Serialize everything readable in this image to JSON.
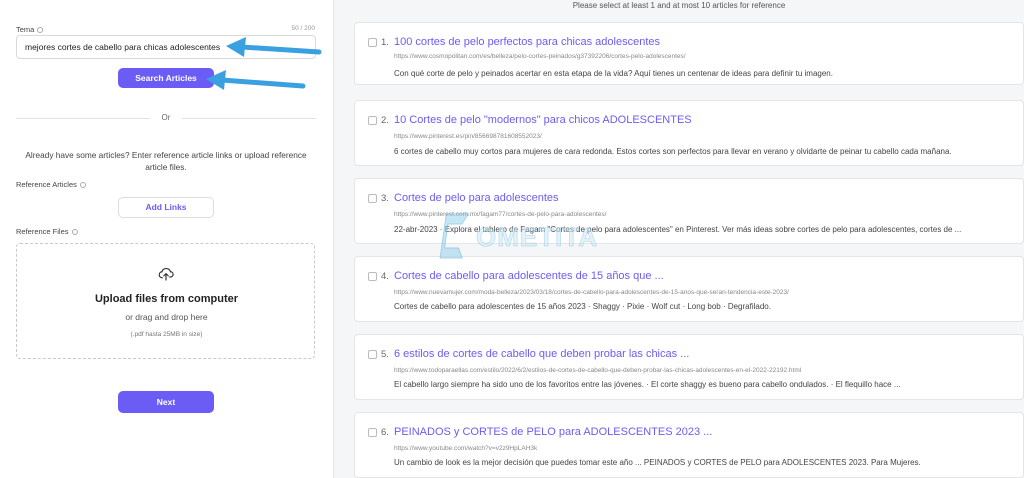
{
  "form": {
    "topic_label": "Tema",
    "counter": "50 / 200",
    "topic_value": "mejores cortes de cabello para chicas adolescentes",
    "search_button": "Search Articles",
    "or_text": "Or",
    "reference_text": "Already have some articles? Enter reference article links or upload reference article files.",
    "reference_articles_label": "Reference Articles",
    "add_links_button": "Add Links",
    "reference_files_label": "Reference Files",
    "upload_title": "Upload files from computer",
    "upload_sub": "or drag and drop here",
    "upload_hint": "(.pdf hasta 25MB in size)",
    "next_button": "Next"
  },
  "results": {
    "instruction": "Please select at least 1 and at most 10 articles for reference",
    "items": [
      {
        "num": "1.",
        "title": "100 cortes de pelo perfectos para chicas adolescentes",
        "url": "https://www.cosmopolitan.com/es/belleza/pelo-cortes-peinados/g37392206/cortes-pelo-adolescentes/",
        "desc": "Con qué corte de pelo y peinados acertar en esta etapa de la vida? Aquí tienes un centenar de ideas para definir tu imagen."
      },
      {
        "num": "2.",
        "title": "10 Cortes de pelo \"modernos\" para chicos ADOLESCENTES",
        "url": "https://www.pinterest.es/pin/856698781608552023/",
        "desc": "6 cortes de cabello muy cortos para mujeres de cara redonda. Estos cortes son perfectos para llevar en verano y olvidarte de peinar tu cabello cada mañana."
      },
      {
        "num": "3.",
        "title": "Cortes de pelo para adolescentes",
        "url": "https://www.pinterest.com.mx/fagam77/cortes-de-pelo-para-adolescentes/",
        "desc": "22-abr-2023 · Explora el tablero de Fagam \"Cortes de pelo para adolescentes\" en Pinterest. Ver más ideas sobre cortes de pelo para adolescentes, cortes de ..."
      },
      {
        "num": "4.",
        "title": "Cortes de cabello para adolescentes de 15 años que ...",
        "url": "https://www.nuevamujer.com/moda-belleza/2023/03/18/cortes-de-cabello-para-adolescentes-de-15-anos-que-seran-tendencia-este-2023/",
        "desc": "Cortes de cabello para adolescentes de 15 años 2023 · Shaggy · Pixie · Wolf cut · Long bob · Degrafilado."
      },
      {
        "num": "5.",
        "title": "6 estilos de cortes de cabello que deben probar las chicas ...",
        "url": "https://www.todoparaellas.com/estilo/2022/6/2/estilos-de-cortes-de-cabello-que-deben-probar-las-chicas-adolescentes-en-el-2022-22192.html",
        "desc": "El cabello largo siempre ha sido uno de los favoritos entre las jóvenes. · El corte shaggy es bueno para cabello ondulados. · El flequillo hace ..."
      },
      {
        "num": "6.",
        "title": "PEINADOS y CORTES de PELO para ADOLESCENTES 2023 ...",
        "url": "https://www.youtube.com/watch?v=v2z9HpLAH3k",
        "desc": "Un cambio de look es la mejor decisión que puedes tomar este año ... PEINADOS y CORTES de PELO para ADOLESCENTES 2023. Para Mujeres."
      }
    ]
  },
  "watermark": {
    "text": "OMETITA"
  },
  "colors": {
    "accent": "#6b5cf6",
    "arrow": "#3aa0e0"
  }
}
